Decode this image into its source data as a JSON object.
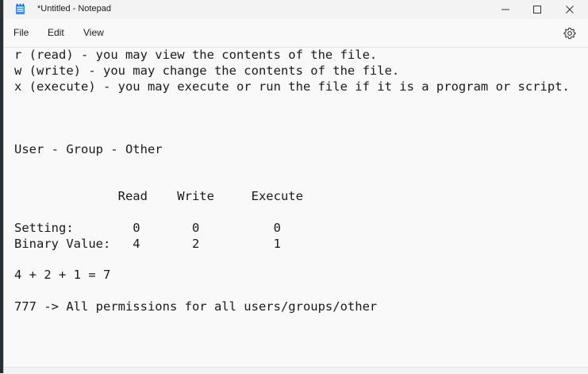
{
  "window": {
    "title": "*Untitled - Notepad"
  },
  "menu": {
    "items": [
      "File",
      "Edit",
      "View"
    ]
  },
  "icons": {
    "app": "notepad-icon",
    "minimize": "minimize-icon",
    "maximize": "maximize-icon",
    "close": "close-icon",
    "settings": "gear-icon"
  },
  "editor": {
    "content": "r (read) - you may view the contents of the file.\nw (write) - you may change the contents of the file.\nx (execute) - you may execute or run the file if it is a program or script.\n\n\n\nUser - Group - Other\n\n\n              Read    Write     Execute\n\nSetting:        0       0          0\nBinary Value:   4       2          1\n\n4 + 2 + 1 = 7\n\n777 -> All permissions for all users/groups/other"
  }
}
